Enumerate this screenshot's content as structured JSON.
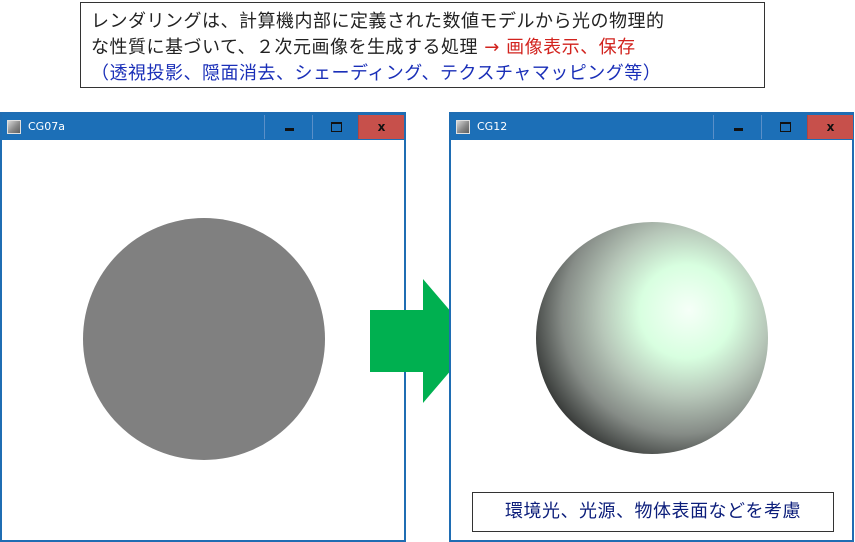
{
  "description_box": {
    "line1": "レンダリングは、計算機内部に定義された数値モデルから光の物理的",
    "line2_main": "な性質に基づいて、２次元画像を生成する処理",
    "line2_arrow": "→ 画像表示、保存",
    "line3": "（透視投影、隠面消去、シェーディング、テクスチャマッピング等）"
  },
  "windows": [
    {
      "title": "CG07a",
      "controls": {
        "close": "x"
      },
      "content": "flat-gray-circle"
    },
    {
      "title": "CG12",
      "controls": {
        "close": "x"
      },
      "content": "shaded-sphere"
    }
  ],
  "arrow": {
    "color": "#00b050",
    "direction": "right"
  },
  "caption": "環境光、光源、物体表面などを考慮",
  "colors": {
    "titlebar": "#1c6fb7",
    "close_button": "#c7504b",
    "flat_circle": "#808080",
    "highlight": "#d8ffe0",
    "red_text": "#d2231e",
    "blue_text": "#1a2fb8",
    "caption_text": "#0b1d7a"
  }
}
